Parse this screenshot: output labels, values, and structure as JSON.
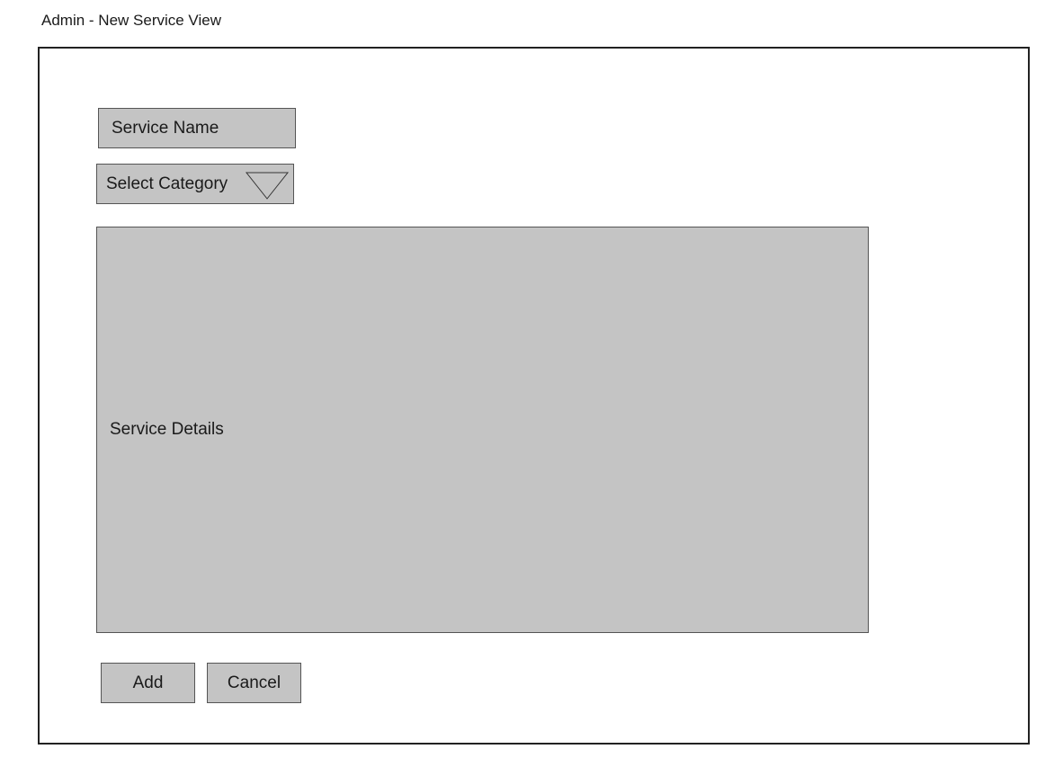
{
  "page": {
    "title": "Admin - New Service View"
  },
  "form": {
    "service_name_placeholder": "Service Name",
    "category_select_label": "Select Category",
    "service_details_placeholder": "Service Details",
    "add_label": "Add",
    "cancel_label": "Cancel"
  },
  "icons": {
    "category_dropdown": "chevron-down-icon"
  },
  "colors": {
    "field_background": "#c4c4c4",
    "border": "#222222",
    "page_background": "#ffffff"
  }
}
